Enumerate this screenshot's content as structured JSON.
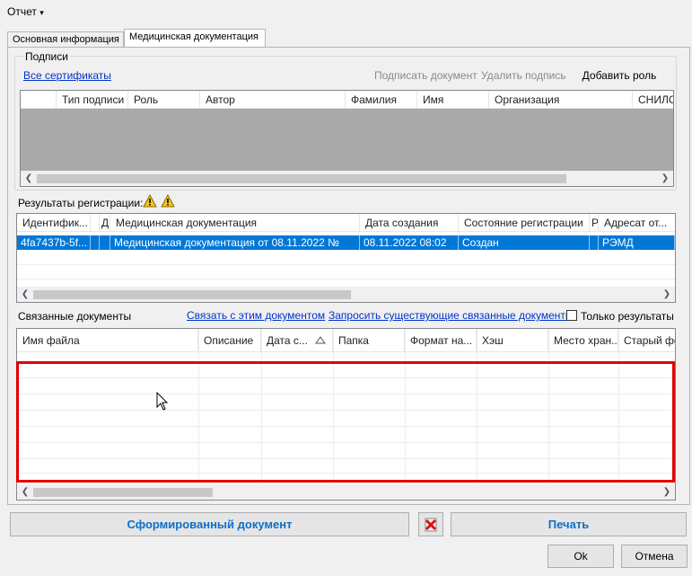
{
  "menu": {
    "report_label": "Отчет",
    "arrow": "▾"
  },
  "tabs": [
    {
      "label": "Основная информация"
    },
    {
      "label": "Медицинская документация"
    }
  ],
  "signatures": {
    "group_label": "Подписи",
    "all_certs_link": "Все сертификаты",
    "sign_doc": "Подписать документ",
    "delete_sig": "Удалить подпись",
    "add_role": "Добавить роль",
    "columns": [
      "Тип подписи",
      "Роль",
      "Автор",
      "Фамилия",
      "Имя",
      "Организация",
      "СНИЛС"
    ]
  },
  "registration": {
    "label": "Результаты регистрации:",
    "columns": [
      "Идентифик...",
      "",
      "Д",
      "Медицинская документация",
      "Дата создания",
      "Состояние регистрации",
      "Р",
      "Адресат от..."
    ],
    "row": {
      "id": "4fa7437b-5f...",
      "doc": "Медицинская документация от 08.11.2022 №",
      "date": "08.11.2022 08:02",
      "state": "Создан",
      "addressee": "РЭМД"
    }
  },
  "related": {
    "label": "Связанные документы",
    "link_connect": "Связать с этим документом",
    "link_request": "Запросить существующие связанные документы",
    "only_results": "Только результаты",
    "only_results_checked": false,
    "columns": [
      "Имя файла",
      "Описание",
      "Дата с...",
      "Папка",
      "Формат на...",
      "Хэш",
      "Место хран...",
      "Старый фо..."
    ]
  },
  "buttons": {
    "formed_doc": "Сформированный документ",
    "print": "Печать",
    "ok": "Ok",
    "cancel": "Отмена"
  },
  "colors": {
    "accent": "#0e6fc7",
    "selection": "#0078d7",
    "highlight": "#e00000"
  }
}
